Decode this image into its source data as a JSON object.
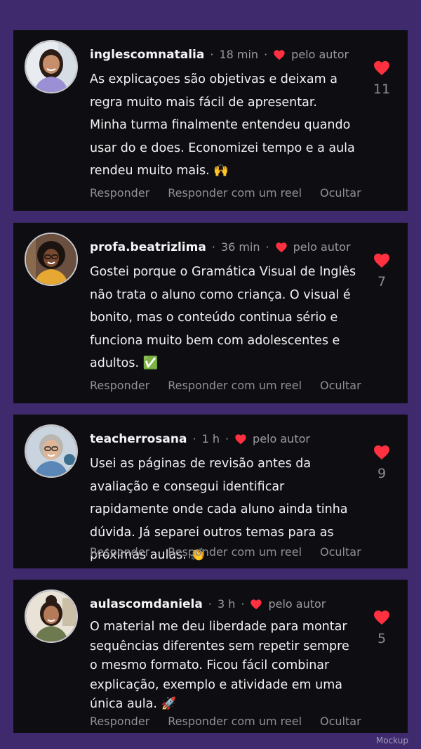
{
  "labels": {
    "by_author": "pelo autor",
    "reply": "Responder",
    "reply_reel": "Responder com um reel",
    "hide": "Ocultar",
    "separator": "·"
  },
  "colors": {
    "background": "#3f2a6e",
    "card": "#0e0e12",
    "heart": "#ff3040"
  },
  "comments": [
    {
      "username": "inglescomnatalia",
      "time": "18 min",
      "text": "As explicaçoes são objetivas e deixam a regra muito mais fácil de apresentar. Minha turma finalmente entendeu quando usar do e does. Economizei tempo e a aula rendeu muito mais. 🙌",
      "likes": "11",
      "liked_by_author": true
    },
    {
      "username": "profa.beatrizlima",
      "time": "36 min",
      "text": "Gostei porque o Gramática Visual de Inglês não trata o aluno como criança. O visual é bonito, mas o conteúdo continua sério e funciona muito bem com adolescentes e adultos. ✅",
      "likes": "7",
      "liked_by_author": true
    },
    {
      "username": "teacherrosana",
      "time": "1 h",
      "text": "Usei as páginas de revisão antes da avaliação e consegui identificar rapidamente onde cada aluno ainda tinha dúvida. Já separei outros temas para as próximas aulas. 👏",
      "likes": "9",
      "liked_by_author": true
    },
    {
      "username": "aulascomdaniela",
      "time": "3 h",
      "text": "O material me deu liberdade para montar sequências diferentes sem repetir sempre o mesmo formato. Ficou fácil combinar explicação, exemplo e atividade em uma única aula. 🚀",
      "likes": "5",
      "liked_by_author": true
    }
  ],
  "watermark": "Mockup"
}
